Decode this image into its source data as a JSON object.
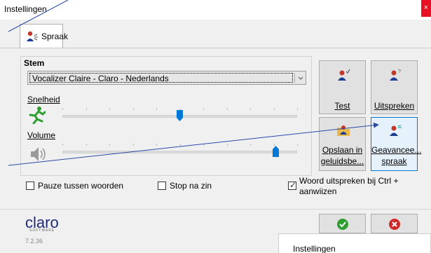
{
  "window": {
    "title": "Instellingen",
    "close_symbol": "×"
  },
  "tabs": [
    {
      "label": "Spraak",
      "icon": "speaker-person-icon"
    }
  ],
  "voice": {
    "group_label": "Stem",
    "selected_voice": "Vocalizer Claire - Claro - Nederlands",
    "speed_label": "Snelheid",
    "speed_value": 0.5,
    "volume_label": "Volume",
    "volume_value": 0.91
  },
  "buttons": {
    "test": "Test",
    "speak": "Uitspreken",
    "save_line1": "Opslaan in",
    "save_line2": "geluidsbe...",
    "advanced_line1": "Geavancee...",
    "advanced_line2": "spraak"
  },
  "options": {
    "pause_between_words": {
      "label": "Pauze tussen woorden",
      "checked": false
    },
    "stop_after_sentence": {
      "label": "Stop na zin",
      "checked": false
    },
    "ctrl_point": {
      "label_line1": "Woord uitspreken bij Ctrl +",
      "label_line2": "aanwijzen",
      "checked": true
    }
  },
  "footer": {
    "brand": "claro",
    "brand_sub": "SOFTWARE",
    "version": "7.2.36"
  },
  "popup": {
    "title": "Instellingen"
  },
  "colors": {
    "accent": "#0078d7",
    "close": "#e81123",
    "thumb": "#0078d7",
    "brand": "#1e2b78"
  }
}
